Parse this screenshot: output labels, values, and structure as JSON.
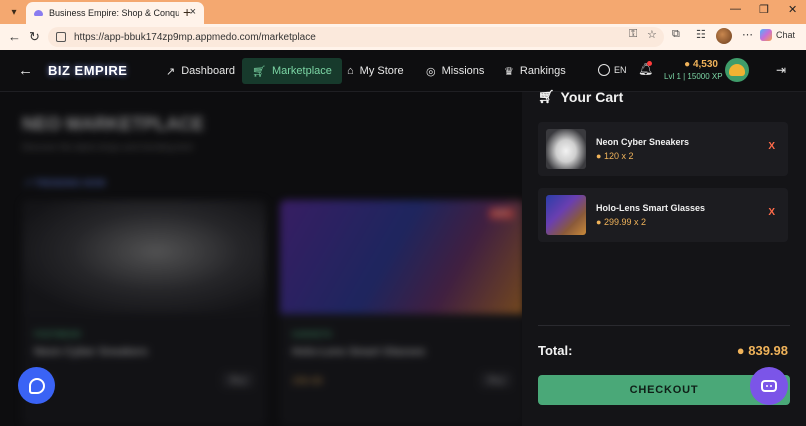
{
  "browser": {
    "tab_title": "Business Empire: Shop & Conquer",
    "url": "https://app-bbuk174zp9mp.appmedo.com/marketplace",
    "copilot_label": "Chat"
  },
  "navbar": {
    "brand": "BIZ EMPIRE",
    "items": [
      {
        "label": "Dashboard",
        "icon": "trending-up-icon"
      },
      {
        "label": "Marketplace",
        "icon": "cart-icon"
      },
      {
        "label": "My Store",
        "icon": "store-icon"
      },
      {
        "label": "Missions",
        "icon": "target-icon"
      },
      {
        "label": "Rankings",
        "icon": "trophy-icon"
      }
    ],
    "active_item": "Marketplace",
    "language": "EN",
    "coins": "4,530",
    "level": "Lvl 1 | 15000 XP"
  },
  "background": {
    "title": "NEO MARKETPLACE",
    "subtitle": "Discover the latest drops and trending tech",
    "trending_label": "TRENDING NOW",
    "cards": [
      {
        "category": "FOOTWEAR",
        "name": "Neon Cyber Sneakers",
        "price": "120",
        "buy": "Buy"
      },
      {
        "category": "GADGETS",
        "name": "Holo-Lens Smart Glasses",
        "price": "299.99",
        "buy": "Buy",
        "badge": "HOT"
      }
    ]
  },
  "cart": {
    "title": "Your Cart",
    "items": [
      {
        "name": "Neon Cyber Sneakers",
        "price_qty": "120 x 2",
        "remove": "X"
      },
      {
        "name": "Holo-Lens Smart Glasses",
        "price_qty": "299.99 x 2",
        "remove": "X"
      }
    ],
    "total_label": "Total:",
    "total_value": "839.98",
    "checkout_label": "CHECKOUT"
  },
  "colors": {
    "accent_green": "#4aa878",
    "coin_gold": "#f0b35a",
    "remove_red": "#ff6b4a",
    "chat_blue": "#3a63f5",
    "bot_purple": "#7b55e8"
  }
}
